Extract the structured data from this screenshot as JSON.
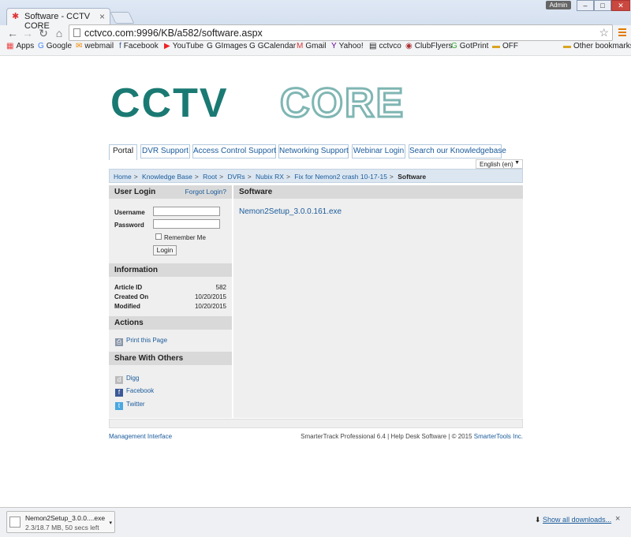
{
  "browser": {
    "tab_title": "Software - CCTV CORE",
    "tab_close": "×",
    "user_label": "Admin",
    "win_min": "–",
    "win_max": "□",
    "win_close": "✕",
    "url": "cctvco.com:9996/KB/a582/software.aspx",
    "bookmarks": [
      "Apps",
      "Google",
      "webmail",
      "Facebook",
      "YouTube",
      "GImages",
      "GCalendar",
      "Gmail",
      "Yahoo!",
      "cctvco",
      "ClubFlyers",
      "GotPrint",
      "OFF"
    ],
    "other_bookmarks": "Other bookmarks"
  },
  "logo": {
    "text_left": "CCTV",
    "text_right": "CORE",
    "color_left": "#1a7a73",
    "color_right": "#7fb6b3"
  },
  "nav_tabs": [
    "Portal",
    "DVR Support",
    "Access Control Support",
    "Networking Support",
    "Webinar Login",
    "Search our Knowledgebase"
  ],
  "language": "English (en)",
  "breadcrumb": [
    "Home",
    "Knowledge Base",
    "Root",
    "DVRs",
    "Nubix RX",
    "Fix for Nemon2 crash 10-17-15"
  ],
  "breadcrumb_current": "Software",
  "user_login": {
    "title": "User Login",
    "forgot": "Forgot Login?",
    "username_label": "Username",
    "password_label": "Password",
    "remember": "Remember Me",
    "login_button": "Login"
  },
  "information": {
    "title": "Information",
    "rows": [
      {
        "k": "Article ID",
        "v": "582"
      },
      {
        "k": "Created On",
        "v": "10/20/2015"
      },
      {
        "k": "Modified",
        "v": "10/20/2015"
      }
    ]
  },
  "actions": {
    "title": "Actions",
    "print": "Print this Page"
  },
  "share": {
    "title": "Share With Others",
    "links": [
      "Digg",
      "Facebook",
      "Twitter"
    ]
  },
  "main": {
    "title": "Software",
    "file": "Nemon2Setup_3.0.0.161.exe"
  },
  "footer": {
    "management": "Management Interface",
    "copyright": "SmarterTrack Professional 6.4 | Help Desk Software | © 2015 ",
    "company": "SmarterTools Inc."
  },
  "download": {
    "name": "Nemon2Setup_3.0.0....exe",
    "status": "2.3/18.7 MB, 50 secs left",
    "show_all": "Show all downloads...",
    "close": "×"
  }
}
